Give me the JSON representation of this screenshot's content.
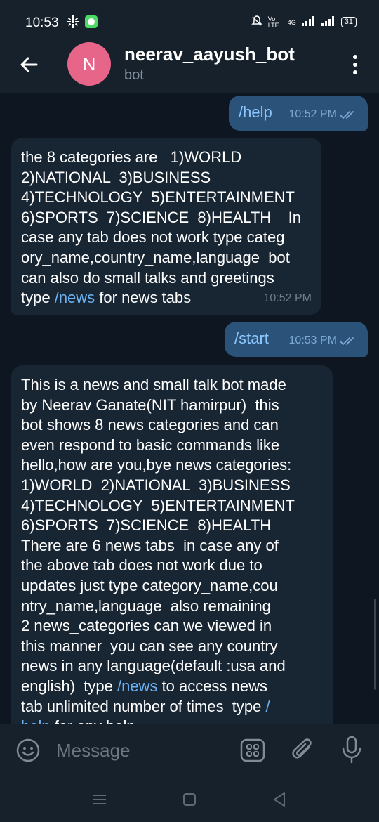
{
  "status_bar": {
    "time": "10:53",
    "network": "4G",
    "volte": "Vo LTE",
    "battery": "31"
  },
  "header": {
    "title": "neerav_aayush_bot",
    "subtitle": "bot",
    "avatar_letter": "N",
    "avatar_color": "#e8658a"
  },
  "messages": [
    {
      "direction": "out",
      "text": "/help",
      "time": "10:52 PM",
      "read": true
    },
    {
      "direction": "in",
      "text_before": "the 8 categories are   1)WORLD\n2)NATIONAL  3)BUSINESS\n4)TECHNOLOGY  5)ENTERTAINMENT\n6)SPORTS  7)SCIENCE  8)HEALTH    In\ncase any tab does not work type categ\nory_name,country_name,language  bot\ncan also do small talks and greetings\ntype ",
      "link": "/news",
      "text_after": " for news tabs",
      "time": "10:52 PM"
    },
    {
      "direction": "out",
      "text": "/start",
      "time": "10:53 PM",
      "read": true
    },
    {
      "direction": "in",
      "text_before": "This is a news and small talk bot made\nby Neerav Ganate(NIT hamirpur)  this\nbot shows 8 news categories and can\neven respond to basic commands like\nhello,how are you,bye news categories:\n1)WORLD  2)NATIONAL  3)BUSINESS\n4)TECHNOLOGY  5)ENTERTAINMENT\n6)SPORTS  7)SCIENCE  8)HEALTH\nThere are 6 news tabs  in case any of\nthe above tab does not work due to\nupdates just type category_name,cou\nntry_name,language  also remaining\n2 news_categories can we viewed in\nthis manner  you can see any country\nnews in any language(default :usa and\nenglish)  type ",
      "link": "/news",
      "text_middle": " to access news\ntab unlimited number of times  type ",
      "link2": "/\nhelp",
      "text_after": " for any help"
    }
  ],
  "input": {
    "placeholder": "Message"
  },
  "colors": {
    "background": "#0e1621",
    "bar": "#17212b",
    "bubble_out": "#2b5278",
    "bubble_in": "#182533",
    "link": "#6ab2f2"
  }
}
